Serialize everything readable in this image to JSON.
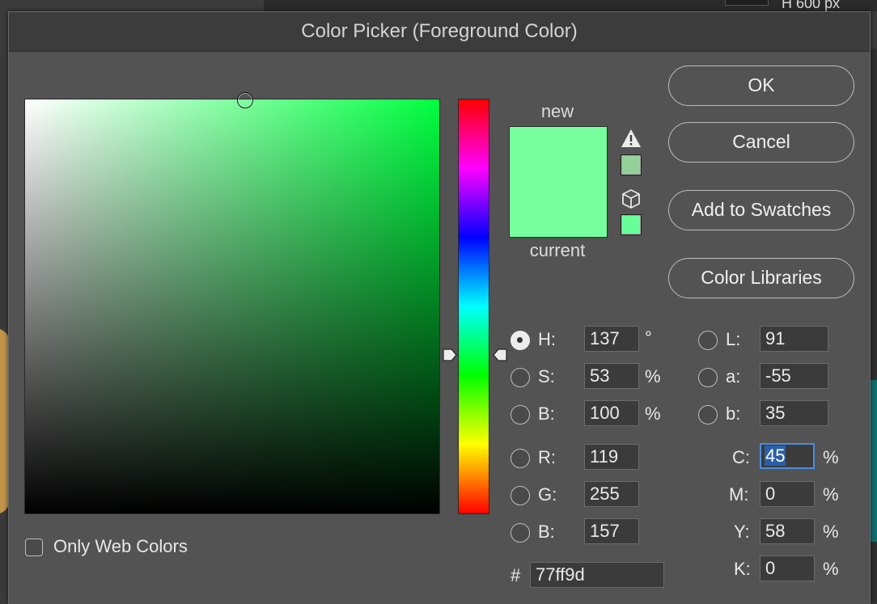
{
  "background": {
    "top_label": "H  600 px"
  },
  "dialog": {
    "title": "Color Picker (Foreground Color)",
    "new_label": "new",
    "current_label": "current",
    "new_color": "#77ff9d",
    "current_color": "#77ff9d",
    "out_of_gamut_color": "#93d198",
    "web_safe_color": "#66ff99",
    "warning_icon": "warning-triangle-icon",
    "web_icon": "cube-icon"
  },
  "buttons": {
    "ok": "OK",
    "cancel": "Cancel",
    "add_to_swatches": "Add to Swatches",
    "color_libraries": "Color Libraries"
  },
  "hsb": {
    "h": {
      "label": "H:",
      "value": "137",
      "unit": "°",
      "selected": true
    },
    "s": {
      "label": "S:",
      "value": "53",
      "unit": "%"
    },
    "b": {
      "label": "B:",
      "value": "100",
      "unit": "%"
    }
  },
  "rgb": {
    "r": {
      "label": "R:",
      "value": "119"
    },
    "g": {
      "label": "G:",
      "value": "255"
    },
    "b": {
      "label": "B:",
      "value": "157"
    }
  },
  "hex": {
    "label": "#",
    "value": "77ff9d"
  },
  "lab": {
    "l": {
      "label": "L:",
      "value": "91"
    },
    "a": {
      "label": "a:",
      "value": "-55"
    },
    "b": {
      "label": "b:",
      "value": "35"
    }
  },
  "cmyk": {
    "c": {
      "label": "C:",
      "value": "45",
      "unit": "%"
    },
    "m": {
      "label": "M:",
      "value": "0",
      "unit": "%"
    },
    "y": {
      "label": "Y:",
      "value": "58",
      "unit": "%"
    },
    "k": {
      "label": "K:",
      "value": "0",
      "unit": "%"
    }
  },
  "only_web_colors": {
    "label": "Only Web Colors",
    "checked": false
  }
}
